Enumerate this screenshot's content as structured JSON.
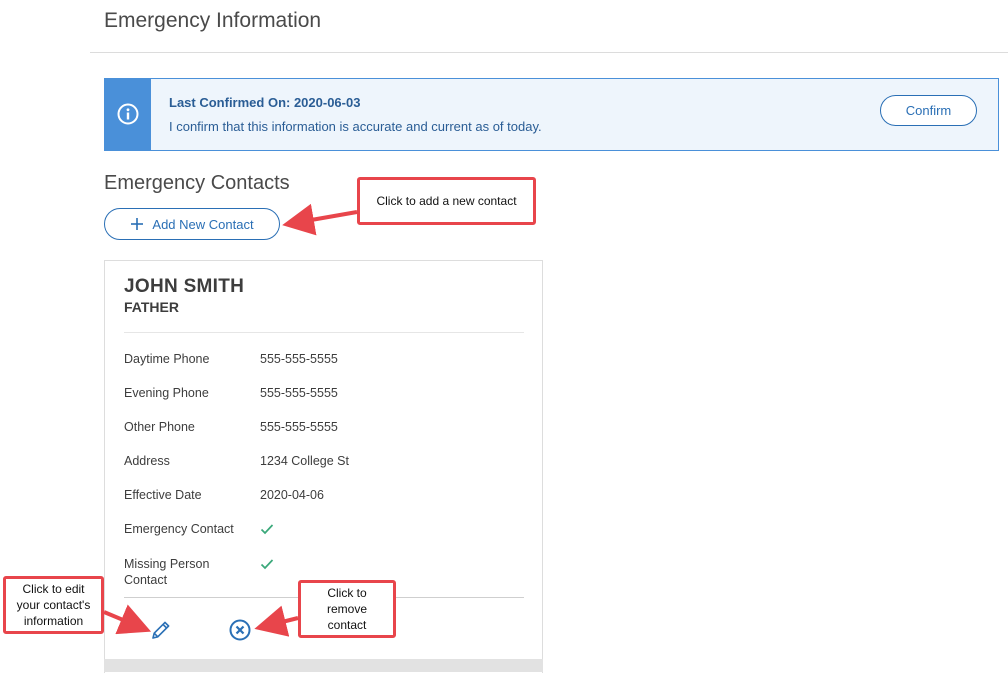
{
  "page": {
    "title": "Emergency Information"
  },
  "banner": {
    "heading": "Last Confirmed On: 2020-06-03",
    "text": "I confirm that this information is accurate and current as of today.",
    "confirm_label": "Confirm",
    "icon": "info-icon"
  },
  "contacts_section": {
    "title": "Emergency Contacts",
    "add_label": "Add New Contact",
    "add_icon": "plus-icon"
  },
  "contact": {
    "name": "JOHN SMITH",
    "relation": "FATHER",
    "fields": [
      {
        "label": "Daytime Phone",
        "value": "555-555-5555"
      },
      {
        "label": "Evening Phone",
        "value": "555-555-5555"
      },
      {
        "label": "Other Phone",
        "value": "555-555-5555"
      },
      {
        "label": "Address",
        "value": "1234 College St"
      },
      {
        "label": "Effective Date",
        "value": "2020-04-06"
      },
      {
        "label": "Emergency Contact",
        "check": true
      },
      {
        "label": "Missing Person Contact",
        "check": true
      }
    ],
    "edit_icon": "pencil-icon",
    "remove_icon": "circle-x-icon"
  },
  "annotations": {
    "add": "Click to add a new contact",
    "edit": "Click to edit your contact's information",
    "remove": "Click to remove contact"
  },
  "colors": {
    "accent": "#2a6fb5",
    "banner_bg": "#eef5fc",
    "banner_icon_bg": "#4a90d9",
    "check": "#3aa87a",
    "callout_border": "#e8454b"
  }
}
